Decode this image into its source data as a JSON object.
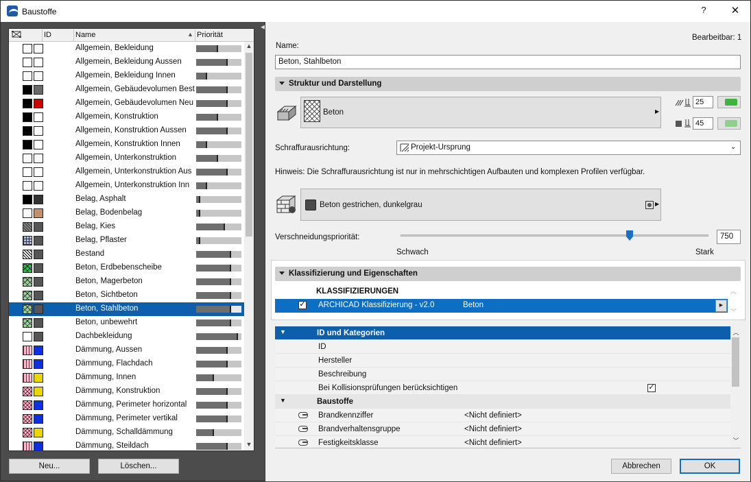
{
  "window": {
    "title": "Baustoffe",
    "help_label": "?",
    "close_label": "✕"
  },
  "list": {
    "headers": {
      "id": "ID",
      "name": "Name",
      "priority": "Priorität"
    },
    "rows": [
      {
        "name": "Allgemein, Bekleidung",
        "priority": 0.5,
        "sw1": "white",
        "sw2": "white"
      },
      {
        "name": "Allgemein, Bekleidung Aussen",
        "priority": 0.72,
        "sw1": "white",
        "sw2": "white"
      },
      {
        "name": "Allgemein, Bekleidung Innen",
        "priority": 0.25,
        "sw1": "white",
        "sw2": "white"
      },
      {
        "name": "Allgemein, Gebäudevolumen Besta",
        "priority": 0.72,
        "sw1": "#000000",
        "sw2": "#6a6a6a"
      },
      {
        "name": "Allgemein, Gebäudevolumen Neu",
        "priority": 0.72,
        "sw1": "#000000",
        "sw2": "#cc0000"
      },
      {
        "name": "Allgemein, Konstruktion",
        "priority": 0.5,
        "sw1": "#000000",
        "sw2": "white"
      },
      {
        "name": "Allgemein, Konstruktion Aussen",
        "priority": 0.72,
        "sw1": "#000000",
        "sw2": "white"
      },
      {
        "name": "Allgemein, Konstruktion Innen",
        "priority": 0.25,
        "sw1": "#000000",
        "sw2": "white"
      },
      {
        "name": "Allgemein, Unterkonstruktion",
        "priority": 0.5,
        "sw1": "white",
        "sw2": "white"
      },
      {
        "name": "Allgemein, Unterkonstruktion Aus",
        "priority": 0.72,
        "sw1": "white",
        "sw2": "white"
      },
      {
        "name": "Allgemein, Unterkonstruktion Inn",
        "priority": 0.25,
        "sw1": "white",
        "sw2": "white"
      },
      {
        "name": "Belag, Asphalt",
        "priority": 0.1,
        "sw1": "#000000",
        "sw2": "#333333"
      },
      {
        "name": "Belag, Bodenbelag",
        "priority": 0.1,
        "sw1": "white",
        "sw2": "#c09070"
      },
      {
        "name": "Belag, Kies",
        "priority": 0.65,
        "sw1": "hatch-gray",
        "sw2": "#555555"
      },
      {
        "name": "Belag, Pflaster",
        "priority": 0.1,
        "sw1": "hatch-blue",
        "sw2": "#555555"
      },
      {
        "name": "Bestand",
        "priority": 0.8,
        "sw1": "hatch-bw",
        "sw2": "#555555"
      },
      {
        "name": "Beton, Erdbebenscheibe",
        "priority": 0.8,
        "sw1": "hatch-g",
        "sw2": "#555555"
      },
      {
        "name": "Beton, Magerbeton",
        "priority": 0.8,
        "sw1": "hatch-lg",
        "sw2": "#555555"
      },
      {
        "name": "Beton, Sichtbeton",
        "priority": 0.8,
        "sw1": "hatch-lg",
        "sw2": "#555555"
      },
      {
        "name": "Beton, Stahlbeton",
        "priority": 0.8,
        "sw1": "hatch-lg",
        "sw2": "#555555",
        "selected": true
      },
      {
        "name": "Beton, unbewehrt",
        "priority": 0.8,
        "sw1": "hatch-lg",
        "sw2": "#555555"
      },
      {
        "name": "Dachbekleidung",
        "priority": 0.95,
        "sw1": "white",
        "sw2": "#555555"
      },
      {
        "name": "Dämmung, Aussen",
        "priority": 0.72,
        "sw1": "hatch-p",
        "sw2": "#1030e0"
      },
      {
        "name": "Dämmung, Flachdach",
        "priority": 0.72,
        "sw1": "hatch-p",
        "sw2": "#1030e0"
      },
      {
        "name": "Dämmung, Innen",
        "priority": 0.4,
        "sw1": "hatch-p",
        "sw2": "#e8d800"
      },
      {
        "name": "Dämmung, Konstruktion",
        "priority": 0.72,
        "sw1": "hatch-pd",
        "sw2": "#e8d800"
      },
      {
        "name": "Dämmung, Perimeter horizontal",
        "priority": 0.72,
        "sw1": "hatch-pd",
        "sw2": "#1030e0"
      },
      {
        "name": "Dämmung, Perimeter vertikal",
        "priority": 0.72,
        "sw1": "hatch-pd",
        "sw2": "#1030e0"
      },
      {
        "name": "Dämmung, Schalldämmung",
        "priority": 0.4,
        "sw1": "hatch-pd",
        "sw2": "#e8d800"
      },
      {
        "name": "Dämmung, Steildach",
        "priority": 0.72,
        "sw1": "hatch-p",
        "sw2": "#1030e0"
      }
    ]
  },
  "buttons": {
    "new": "Neu...",
    "delete": "Löschen...",
    "cancel": "Abbrechen",
    "ok": "OK"
  },
  "detail": {
    "editable": "Bearbeitbar: 1",
    "name_label": "Name:",
    "name_value": "Beton, Stahlbeton",
    "section_struct": "Struktur und Darstellung",
    "fill_name": "Beton",
    "pen1": "25",
    "pen2": "45",
    "pen1_color": "#3fb23f",
    "pen2_color": "#8fd08f",
    "orientation_label": "Schraffurausrichtung:",
    "orientation_value": "Projekt-Ursprung",
    "hint": "Hinweis: Die Schraffurausrichtung ist nur in mehrschichtigen Aufbauten und komplexen Profilen verfügbar.",
    "surface_name": "Beton gestrichen, dunkelgrau",
    "surface_color": "#4a4a4a",
    "priority_label": "Verschneidungspriorität:",
    "priority_value": "750",
    "weak": "Schwach",
    "strong": "Stark",
    "section_klass": "Klassifizierung und Eigenschaften",
    "klass_header": "KLASSIFIZIERUNGEN",
    "klass_system": "ARCHICAD Klassifizierung - v2.0",
    "klass_value": "Beton",
    "props": {
      "group1": "ID und Kategorien",
      "id": "ID",
      "manufacturer": "Hersteller",
      "description": "Beschreibung",
      "collision": "Bei Kollisionsprüfungen berücksichtigen",
      "group2": "Baustoffe",
      "p1": "Brandkennziffer",
      "p2": "Brandverhaltensgruppe",
      "p3": "Festigkeitsklasse",
      "undefined": "<Nicht definiert>"
    }
  }
}
